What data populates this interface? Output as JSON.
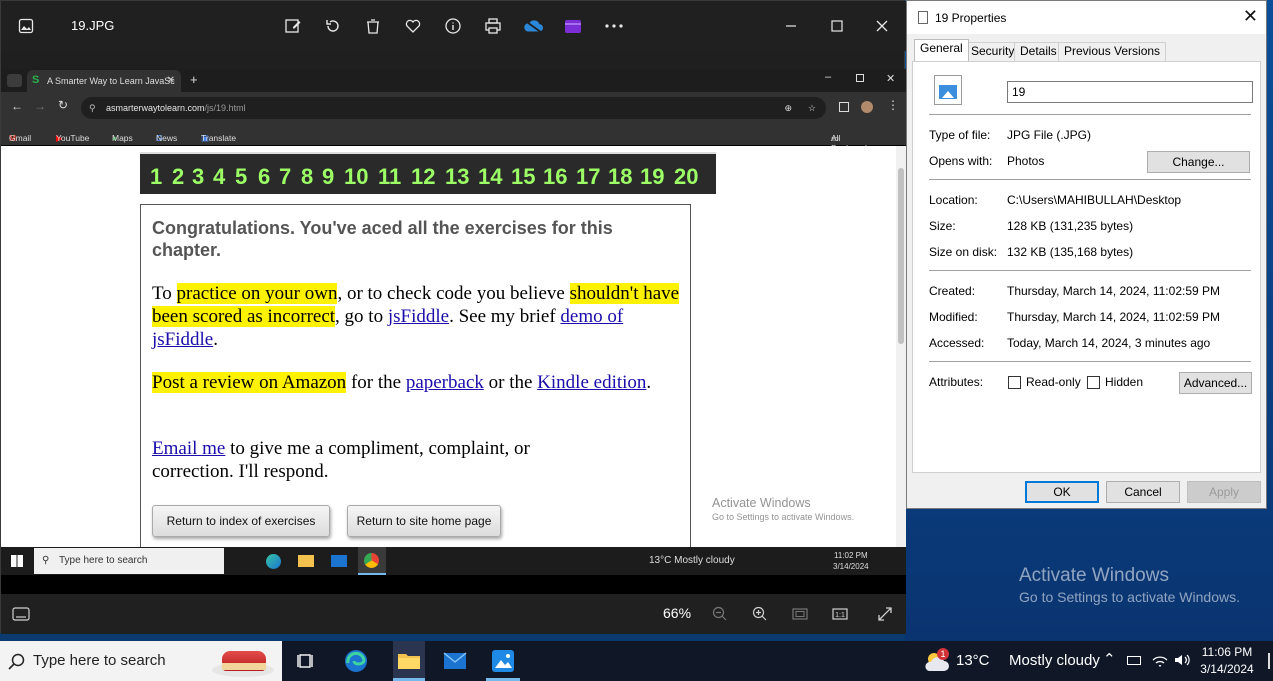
{
  "photos": {
    "title": "19.JPG",
    "zoom": "66%"
  },
  "browser": {
    "tab_title": "A Smarter Way to Learn JavaSc",
    "url_host": "asmarterwaytolearn.com",
    "url_path": "/js/19.html",
    "bookmarks": [
      "Gmail",
      "YouTube",
      "Maps",
      "News",
      "Translate"
    ],
    "all_bookmarks": "All Bookmarks"
  },
  "webpage": {
    "numbers": [
      "1",
      "2",
      "3",
      "4",
      "5",
      "6",
      "7",
      "8",
      "9",
      "10",
      "11",
      "12",
      "13",
      "14",
      "15",
      "16",
      "17",
      "18",
      "19",
      "20"
    ],
    "congrats": "Congratulations. You've aced all the exercises for this chapter.",
    "p1_a": "To ",
    "p1_hl1": "practice on your own",
    "p1_b": ", or to check code you believe ",
    "p1_hl2": "shouldn't have been scored as incorrect",
    "p1_c": ", go to ",
    "p1_link1": "jsFiddle",
    "p1_d": ". See my brief ",
    "p1_link2": "demo of jsFiddle",
    "p1_e": ".",
    "p2_hl": "Post a review on Amazon",
    "p2_a": " for the ",
    "p2_link1": "paperback",
    "p2_b": " or the ",
    "p2_link2": "Kindle edition",
    "p2_c": ".",
    "p3_link": "Email me",
    "p3_a": " to give me a compliment, complaint, or correction. I'll respond.",
    "btn_index": "Return to index of exercises",
    "btn_home": "Return to site home page"
  },
  "inner_watermark": {
    "line1": "Activate Windows",
    "line2": "Go to Settings to activate Windows."
  },
  "inner_taskbar": {
    "search": "Type here to search",
    "weather": "13°C  Mostly cloudy",
    "time": "11:02 PM",
    "date": "3/14/2024"
  },
  "properties": {
    "title": "19 Properties",
    "tabs": [
      "General",
      "Security",
      "Details",
      "Previous Versions"
    ],
    "filename": "19",
    "type_label": "Type of file:",
    "type_value": "JPG File (.JPG)",
    "opens_label": "Opens with:",
    "opens_value": "Photos",
    "change_btn": "Change...",
    "location_label": "Location:",
    "location_value": "C:\\Users\\MAHIBULLAH\\Desktop",
    "size_label": "Size:",
    "size_value": "128 KB (131,235 bytes)",
    "sizedisk_label": "Size on disk:",
    "sizedisk_value": "132 KB (135,168 bytes)",
    "created_label": "Created:",
    "created_value": "Thursday, March 14, 2024, 11:02:59 PM",
    "modified_label": "Modified:",
    "modified_value": "Thursday, March 14, 2024, 11:02:59 PM",
    "accessed_label": "Accessed:",
    "accessed_value": "Today, March 14, 2024, 3 minutes ago",
    "attributes_label": "Attributes:",
    "readonly_label": "Read-only",
    "hidden_label": "Hidden",
    "advanced_btn": "Advanced...",
    "ok_btn": "OK",
    "cancel_btn": "Cancel",
    "apply_btn": "Apply"
  },
  "watermark": {
    "line1": "Activate Windows",
    "line2": "Go to Settings to activate Windows."
  },
  "taskbar": {
    "search": "Type here to search",
    "weather_temp": "13°C",
    "weather_desc": "Mostly cloudy",
    "weather_badge": "1",
    "time": "11:06 PM",
    "date": "3/14/2024"
  }
}
